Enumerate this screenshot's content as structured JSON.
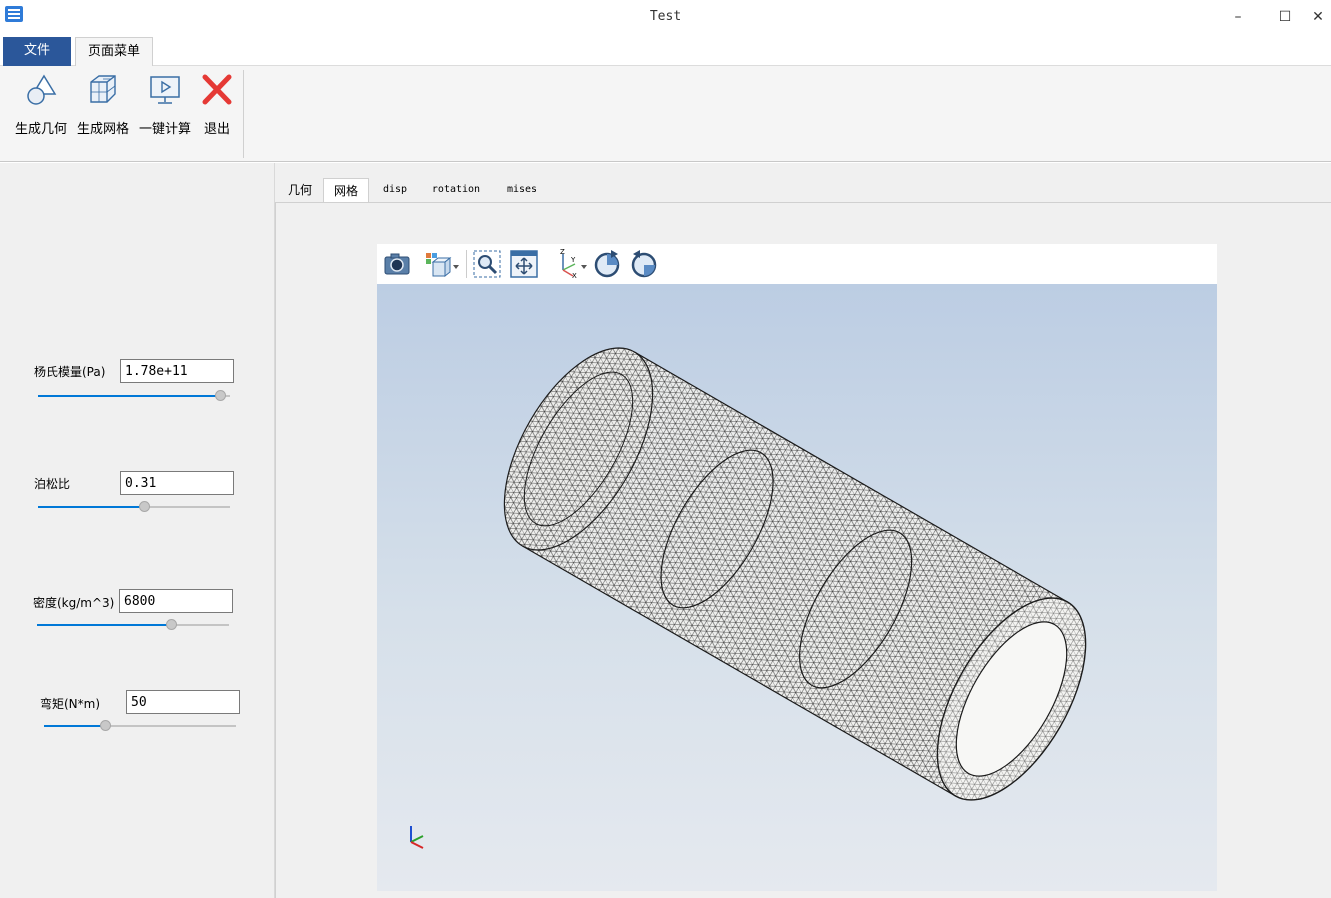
{
  "window": {
    "title": "Test",
    "minimize_glyph": "–",
    "maximize_glyph": "☐",
    "close_glyph": "✕"
  },
  "ribbon": {
    "tabs": [
      {
        "label": "文件",
        "active": false
      },
      {
        "label": "页面菜单",
        "active": true
      }
    ],
    "buttons": [
      {
        "label": "生成几何",
        "icon": "geometry-icon"
      },
      {
        "label": "生成网格",
        "icon": "mesh-cube-icon"
      },
      {
        "label": "一键计算",
        "icon": "compute-monitor-icon"
      },
      {
        "label": "退出",
        "icon": "exit-x-icon"
      }
    ]
  },
  "params": [
    {
      "label": "杨氏模量(Pa)",
      "value": "1.78e+11",
      "slider_fraction": 0.95
    },
    {
      "label": "泊松比",
      "value": "0.31",
      "slider_fraction": 0.55
    },
    {
      "label": "密度(kg/m^3)",
      "value": "6800",
      "slider_fraction": 0.7
    },
    {
      "label": "弯矩(N*m)",
      "value": "50",
      "slider_fraction": 0.32
    }
  ],
  "view_tabs": [
    {
      "label": "几何",
      "active": false
    },
    {
      "label": "网格",
      "active": true
    },
    {
      "label": "disp",
      "active": false
    },
    {
      "label": "rotation",
      "active": false
    },
    {
      "label": "mises",
      "active": false
    }
  ],
  "viewer_toolbar": [
    "camera-screenshot-icon",
    "view-cube-dropdown-icon",
    "zoom-box-icon",
    "fit-view-icon",
    "axes-dropdown-icon",
    "rotate-cw-icon",
    "rotate-ccw-icon"
  ],
  "colors": {
    "accent": "#2b579a",
    "slider_fill": "#0078d7",
    "exit_red": "#e53935",
    "mesh_line": "#1a1a1a"
  }
}
